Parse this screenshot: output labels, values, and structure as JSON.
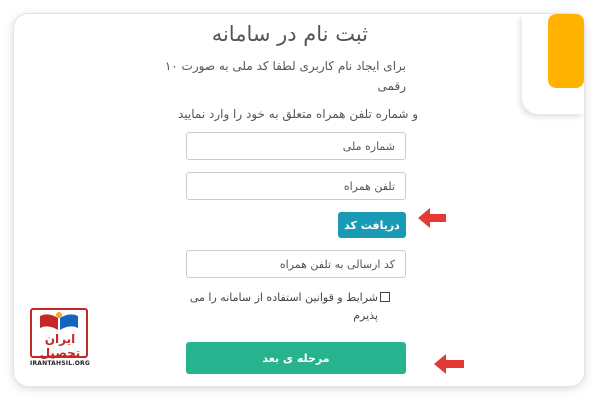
{
  "form": {
    "title": "ثبت نام در سامانه",
    "desc_line1": "برای ایجاد نام کاربری لطفا کد ملی به صورت ۱۰",
    "desc_line2": "رقمی",
    "desc_line3": "و شماره تلفن همراه متعلق به خود را وارد نمایید",
    "national_id_placeholder": "شماره ملی",
    "phone_placeholder": "تلفن همراه",
    "get_code_label": "دریافت کد",
    "sms_code_placeholder": "کد ارسالی به تلفن همراه",
    "terms_line1": "شرایط و قوانین استفاده از سامانه را می",
    "terms_line2": "پذیرم",
    "next_label": "مرحله ی بعد"
  },
  "brand": {
    "logo_name": "ایران تحصیل",
    "logo_url": "IRANTAHSIL.ORG",
    "accent_orange": "#FFB300",
    "button_teal": "#1a9bb5",
    "button_green": "#28b38f",
    "arrow_red": "#e53935"
  },
  "icons": {
    "annotation_arrow": "arrow-left-icon",
    "checkbox": "checkbox-icon",
    "logo": "irantahsil-logo"
  }
}
